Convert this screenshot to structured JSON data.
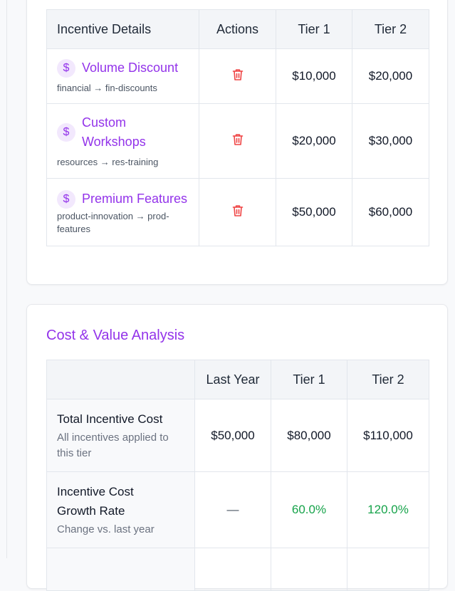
{
  "incentives_table": {
    "headers": [
      "Incentive Details",
      "Actions",
      "Tier 1",
      "Tier 2"
    ],
    "rows": [
      {
        "name": "Volume Discount",
        "path": "financial → fin-discounts",
        "tier1": "$10,000",
        "tier2": "$20,000"
      },
      {
        "name": "Custom Workshops",
        "path": "resources → res-training",
        "tier1": "$20,000",
        "tier2": "$30,000"
      },
      {
        "name": "Premium Features",
        "path": "product-innovation → prod-features",
        "tier1": "$50,000",
        "tier2": "$60,000"
      }
    ],
    "icon_symbol": "$"
  },
  "cost_analysis": {
    "title": "Cost & Value Analysis",
    "headers": [
      "",
      "Last Year",
      "Tier 1",
      "Tier 2"
    ],
    "rows": [
      {
        "label": "Total Incentive Cost",
        "sub": "All incentives applied to this tier",
        "last_year": "$50,000",
        "tier1": "$80,000",
        "tier2": "$110,000"
      },
      {
        "label": "Incentive Cost Growth Rate",
        "sub": "Change vs. last year",
        "last_year": "—",
        "tier1": "60.0%",
        "tier2": "120.0%"
      }
    ]
  },
  "colors": {
    "accent": "#9333ea",
    "delete": "#ef4444",
    "positive": "#16a34a"
  }
}
